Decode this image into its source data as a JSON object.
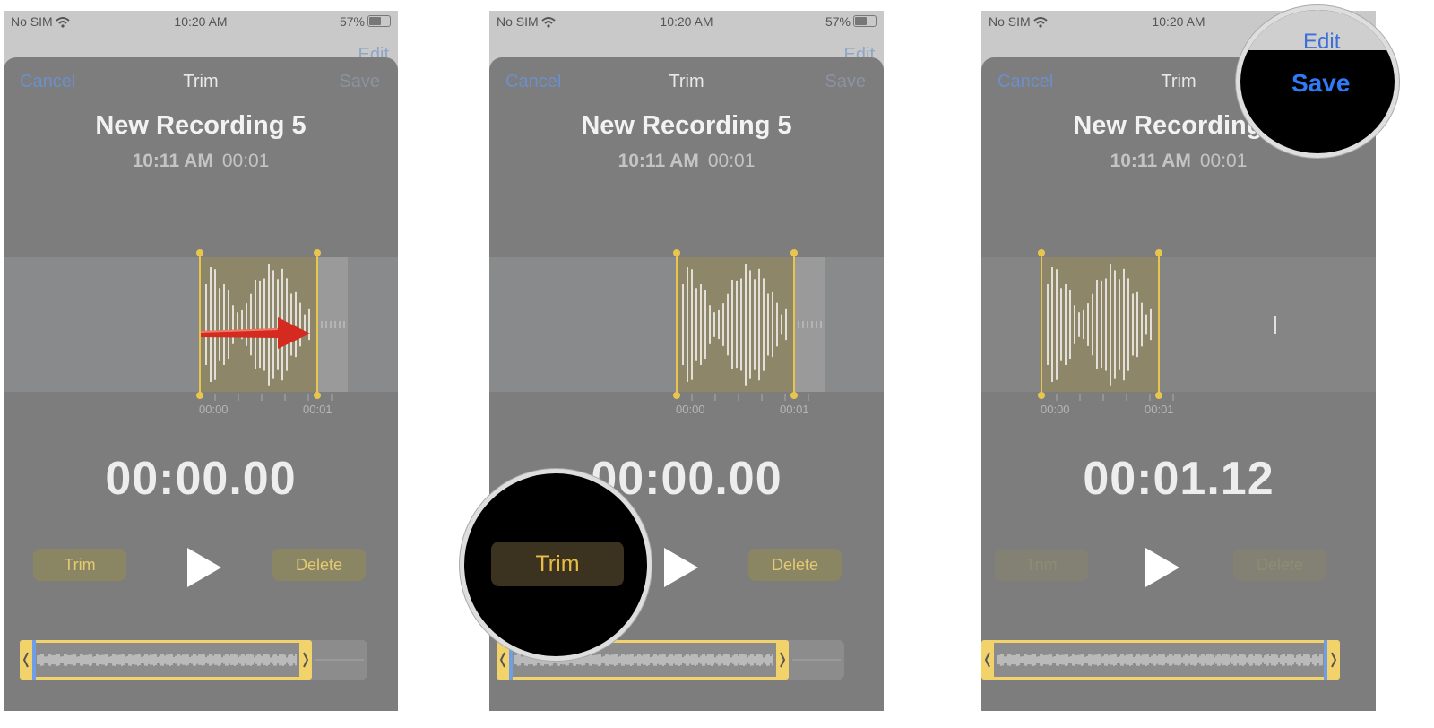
{
  "status": {
    "carrier": "No SIM",
    "time": "10:20 AM",
    "battery": "57%"
  },
  "behind_edit": "Edit",
  "nav": {
    "cancel": "Cancel",
    "title": "Trim",
    "save": "Save"
  },
  "recording": {
    "title": "New Recording 5",
    "time": "10:11 AM",
    "duration": "00:01"
  },
  "timeline": {
    "start": "00:00",
    "end": "00:01"
  },
  "buttons": {
    "trim": "Trim",
    "delete": "Delete"
  },
  "panels": [
    {
      "timer": "00:00.00"
    },
    {
      "timer": "00:00.00"
    },
    {
      "timer": "00:01.12"
    }
  ],
  "callouts": {
    "trim_button": "Trim",
    "edit_button": "Edit",
    "save_button": "Save"
  },
  "colors": {
    "accent_yellow": "#e8c54c",
    "link_blue": "#6c8fcc",
    "save_blue": "#2f7af6",
    "arrow_red": "#d42a1f"
  }
}
